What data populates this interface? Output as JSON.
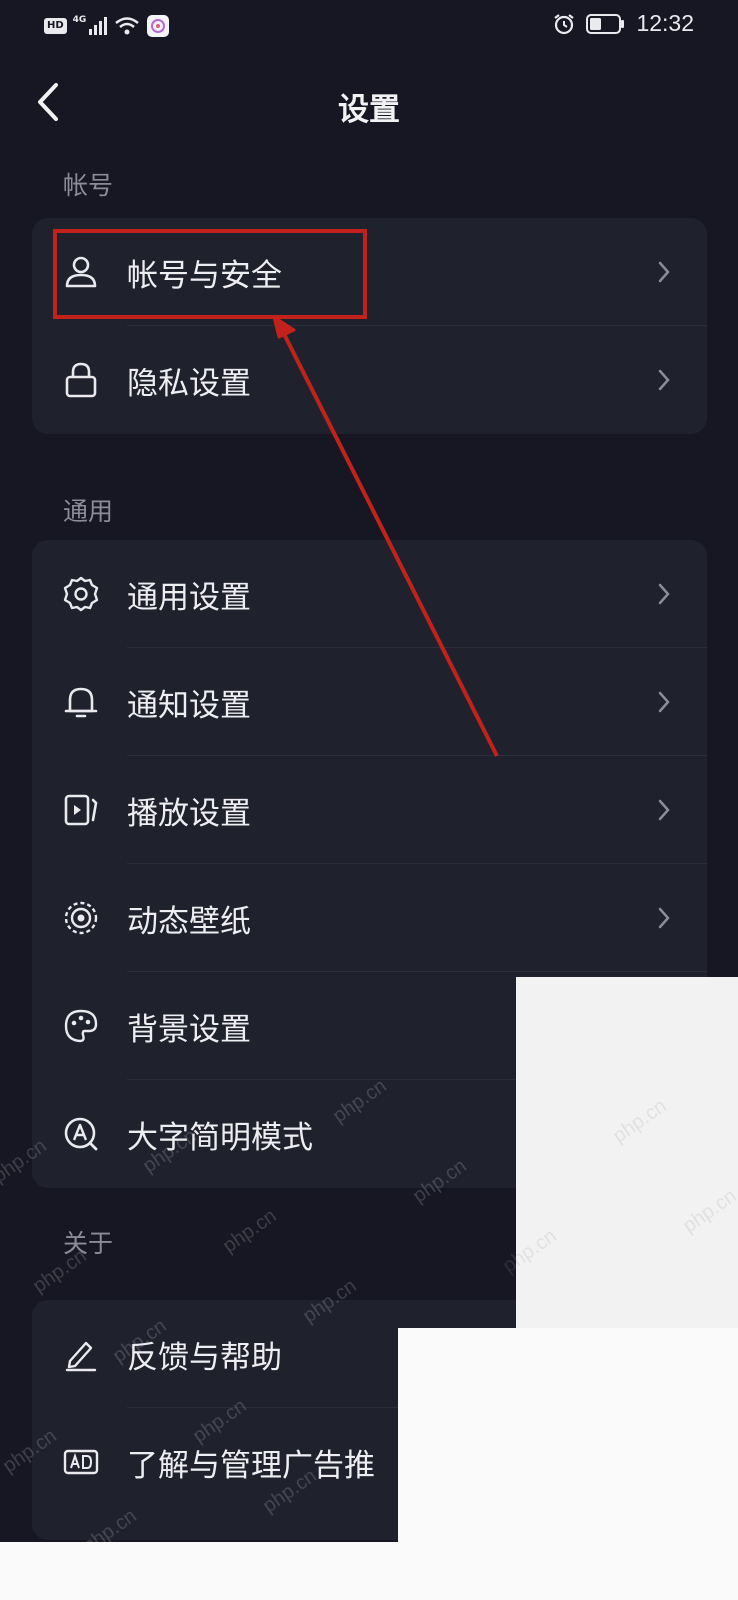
{
  "status_bar": {
    "hd": "HD",
    "network": "4G",
    "time": "12:32"
  },
  "header": {
    "title": "设置"
  },
  "sections": {
    "account": {
      "label": "帐号",
      "items": [
        {
          "label": "帐号与安全",
          "icon": "user-icon"
        },
        {
          "label": "隐私设置",
          "icon": "lock-icon"
        }
      ]
    },
    "general": {
      "label": "通用",
      "items": [
        {
          "label": "通用设置",
          "icon": "gear-icon"
        },
        {
          "label": "通知设置",
          "icon": "bell-icon"
        },
        {
          "label": "播放设置",
          "icon": "play-icon"
        },
        {
          "label": "动态壁纸",
          "icon": "target-icon"
        },
        {
          "label": "背景设置",
          "icon": "palette-icon"
        },
        {
          "label": "大字简明模式",
          "icon": "font-a-icon"
        }
      ]
    },
    "about": {
      "label": "关于",
      "items": [
        {
          "label": "反馈与帮助",
          "icon": "pen-icon"
        },
        {
          "label": "了解与管理广告推",
          "icon": "ad-icon"
        }
      ]
    }
  },
  "watermark": "php.cn",
  "colors": {
    "background": "#161722",
    "card": "#1f212d",
    "annotation_red": "#c3221c",
    "muted_text": "#8b8c97"
  }
}
